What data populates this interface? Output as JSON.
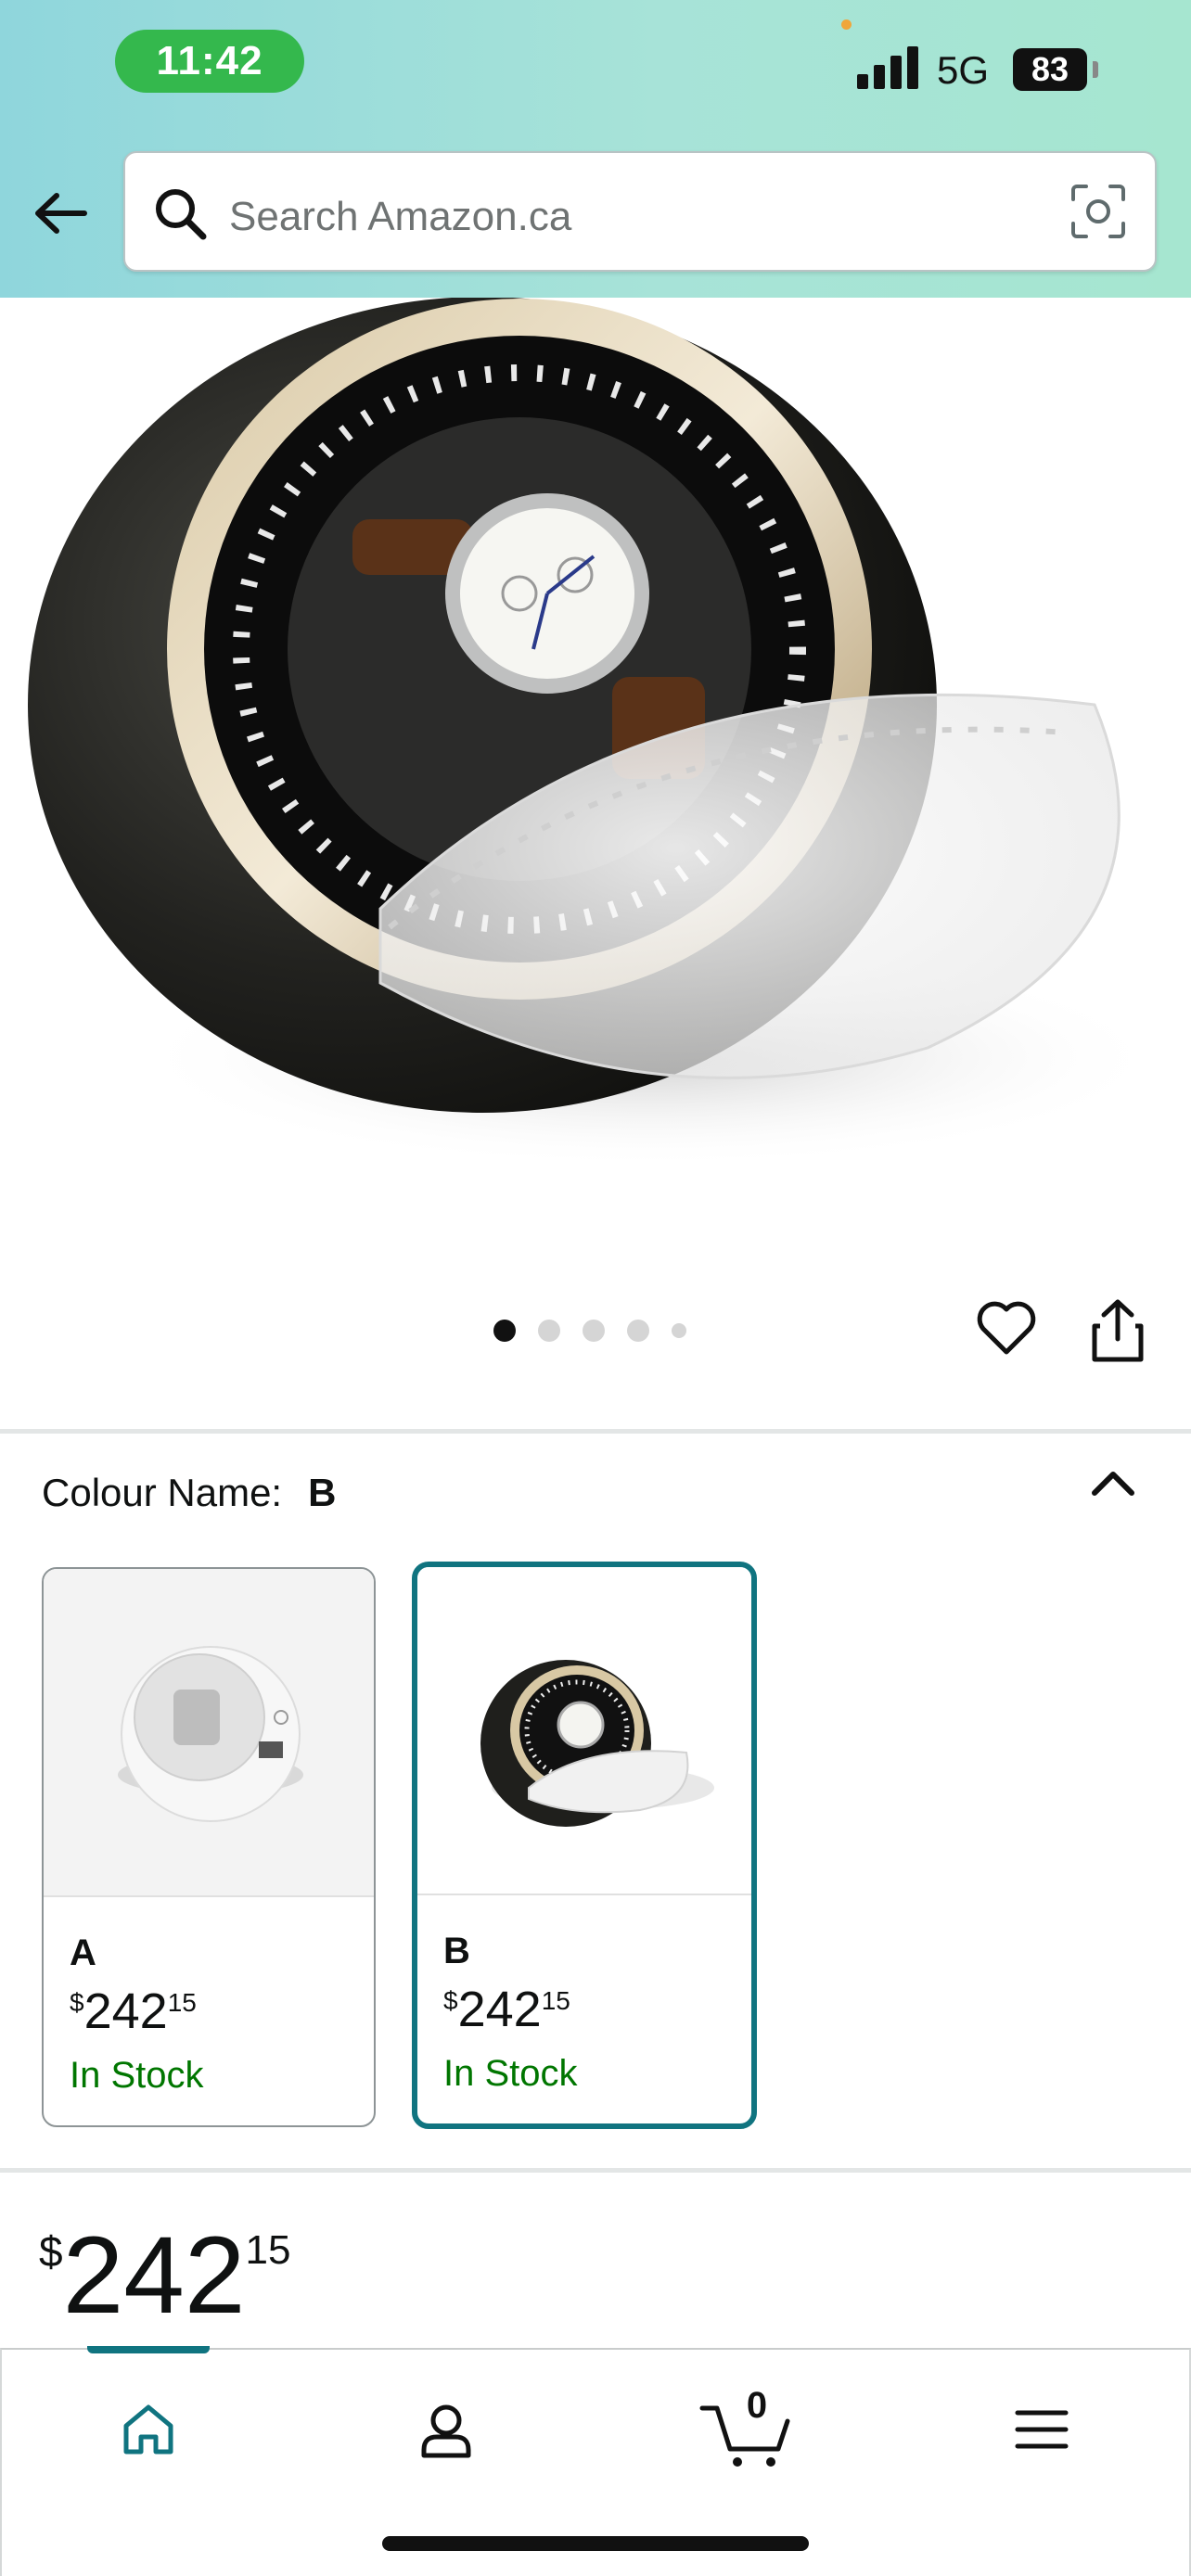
{
  "status_bar": {
    "time": "11:42",
    "network": "5G",
    "battery": "83"
  },
  "search": {
    "placeholder": "Search Amazon.ca"
  },
  "gallery": {
    "image_count": 5,
    "active_index": 0
  },
  "variant_selector": {
    "label": "Colour Name:",
    "selected_value": "B",
    "options": [
      {
        "name": "A",
        "price_currency": "$",
        "price_whole": "242",
        "price_fraction": "15",
        "stock": "In Stock",
        "selected": false
      },
      {
        "name": "B",
        "price_currency": "$",
        "price_whole": "242",
        "price_fraction": "15",
        "stock": "In Stock",
        "selected": true
      }
    ]
  },
  "price": {
    "currency": "$",
    "whole": "242",
    "fraction": "15"
  },
  "bottom_nav": {
    "active": "home",
    "cart_count": "0",
    "items": [
      "home-icon",
      "account-icon",
      "cart-icon",
      "menu-icon"
    ]
  },
  "colors": {
    "accent_teal": "#107480",
    "in_stock_green": "#007600",
    "header_gradient_start": "#8fd6dc",
    "header_gradient_end": "#a6e6d0"
  }
}
